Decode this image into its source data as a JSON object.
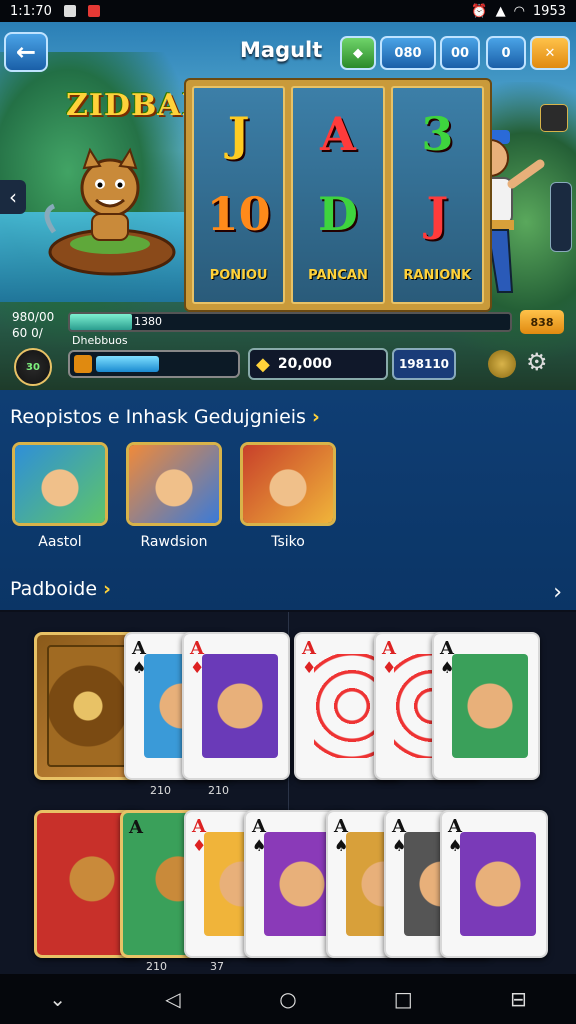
{
  "status_bar": {
    "time": "1:1:70",
    "right_text": "1953"
  },
  "header": {
    "title": "Magult",
    "buttons": [
      "",
      "080",
      "00",
      "0",
      ""
    ]
  },
  "logo": "ZIDBAIUS",
  "reels": [
    {
      "top": "J",
      "mid": "10",
      "caption": "PONIOU",
      "top_color": "#ffcc22",
      "mid_color": "#ff8a1a"
    },
    {
      "top": "A",
      "mid": "D",
      "caption": "PANCAN",
      "top_color": "#ff3b3b",
      "mid_color": "#3ed43e"
    },
    {
      "top": "3",
      "mid": "J",
      "caption": "RANIONK",
      "top_color": "#3ed43e",
      "mid_color": "#ff3b3b"
    }
  ],
  "stats": {
    "line1": "980/00",
    "line2": "60 0/",
    "badge": "30"
  },
  "progress": {
    "label": "1380",
    "fraction": 0.14,
    "button": "838",
    "sub_label": "Dhebbuos"
  },
  "energy": {
    "fraction": 0.45
  },
  "balance": {
    "value": "20,000"
  },
  "bet": {
    "value": "198110"
  },
  "section1": {
    "title": "Reopistos e Inhask Gedujgnieis",
    "items": [
      {
        "label": "Aastol",
        "color1": "#2f8fd8",
        "color2": "#5ec46a"
      },
      {
        "label": "Rawdsion",
        "color1": "#f08a3a",
        "color2": "#3a7ad8"
      },
      {
        "label": "Tsiko",
        "color1": "#c8402a",
        "color2": "#f0b43a"
      }
    ]
  },
  "section2": {
    "title": "Padboide"
  },
  "cards_row1": [
    {
      "type": "back"
    },
    {
      "rank": "A",
      "suit": "♠",
      "suit_color": "#111",
      "art": "#3a9ad8",
      "label": "210"
    },
    {
      "rank": "A",
      "suit": "♦",
      "suit_color": "#d22",
      "art": "#6a3ab8",
      "label": "210"
    },
    {
      "rank": "A",
      "suit": "♦",
      "suit_color": "#d22",
      "art": "#ffffff",
      "label": ""
    },
    {
      "rank": "A",
      "suit": "♦",
      "suit_color": "#d22",
      "art": "#ffffff",
      "label": ""
    },
    {
      "rank": "A",
      "suit": "♠",
      "suit_color": "#111",
      "art": "#3aa05a",
      "label": ""
    }
  ],
  "cards_row2": [
    {
      "type": "red",
      "art": "#c8302a"
    },
    {
      "type": "green",
      "rank": "A",
      "art": "#3aa05a",
      "label": "210"
    },
    {
      "rank": "A",
      "suit": "♦",
      "suit_color": "#d22",
      "art": "#f0b43a",
      "label": "37"
    },
    {
      "rank": "A",
      "suit": "♠",
      "suit_color": "#111",
      "art": "#8a3ab8",
      "label": ""
    },
    {
      "rank": "A",
      "suit": "♠",
      "suit_color": "#111",
      "art": "#d8a03a",
      "label": ""
    },
    {
      "rank": "A",
      "suit": "♠",
      "suit_color": "#111",
      "art": "#555555",
      "label": ""
    },
    {
      "rank": "A",
      "suit": "♠",
      "suit_color": "#111",
      "art": "#7a3ab8",
      "label": ""
    }
  ],
  "nav": [
    "chevron-down",
    "back",
    "home",
    "recents",
    "screenshot"
  ]
}
